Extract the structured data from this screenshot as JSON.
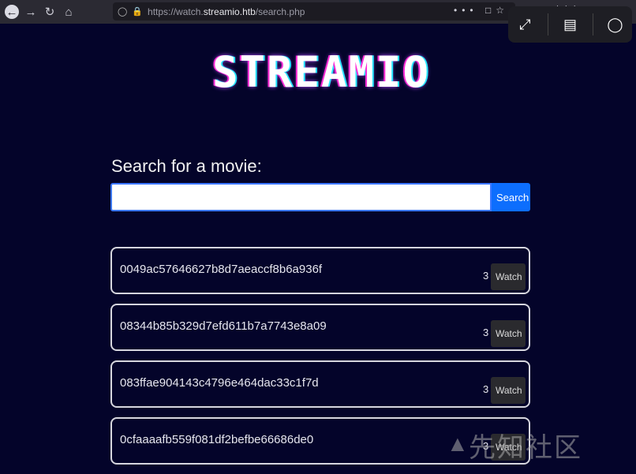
{
  "browser": {
    "url_prefix": "https://watch.",
    "url_domain": "streamio.htb",
    "url_path": "/search.php",
    "menu_glyph": "•••"
  },
  "overlay": {
    "icons": [
      "expand-icon",
      "text-scan-icon",
      "chat-icon"
    ]
  },
  "logo": {
    "text": "STREAMIO",
    "colors": {
      "main": "#ffffff",
      "left_shadow": "#ff2bd6",
      "right_shadow": "#27e6ff"
    }
  },
  "search": {
    "label": "Search for a movie:",
    "value": "",
    "placeholder": "",
    "button_label": "Search"
  },
  "results": [
    {
      "name": "0049ac57646627b8d7aeaccf8b6a936f",
      "count": "3",
      "action": "Watch"
    },
    {
      "name": "08344b85b329d7efd611b7a7743e8a09",
      "count": "3",
      "action": "Watch"
    },
    {
      "name": "083ffae904143c4796e464dac33c1f7d",
      "count": "3",
      "action": "Watch"
    },
    {
      "name": "0cfaaaafb559f081df2befbe66686de0",
      "count": "3",
      "action": "Watch"
    }
  ],
  "watermark": {
    "text": "先知社区"
  },
  "colors": {
    "background": "#04042a",
    "primary": "#0d6efd"
  }
}
